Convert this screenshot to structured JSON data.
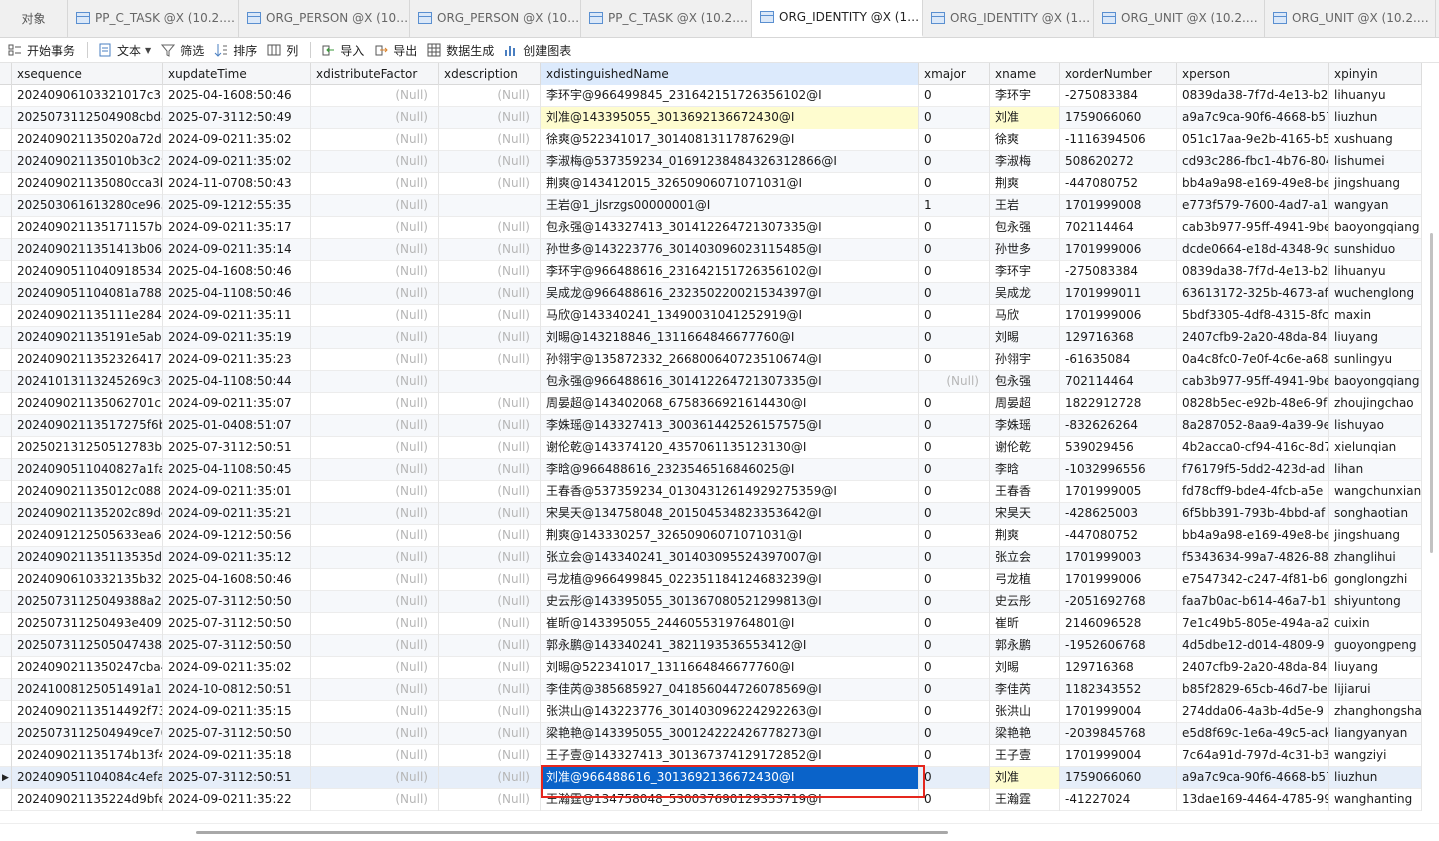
{
  "tabs": {
    "object_label": "对象",
    "items": [
      {
        "label": "PP_C_TASK @X (10.2.1..."
      },
      {
        "label": "ORG_PERSON @X (10...."
      },
      {
        "label": "ORG_PERSON @X (10...."
      },
      {
        "label": "PP_C_TASK @X (10.2.1..."
      },
      {
        "label": "ORG_IDENTITY @X (10...."
      },
      {
        "label": "ORG_IDENTITY @X (10..."
      },
      {
        "label": "ORG_UNIT @X (10.2.1..."
      },
      {
        "label": "ORG_UNIT @X (10.2.1..."
      }
    ]
  },
  "toolbar": {
    "begin_transaction": "开始事务",
    "text": "文本",
    "filter": "筛选",
    "sort": "排序",
    "columns": "列",
    "import": "导入",
    "export": "导出",
    "generate_data": "数据生成",
    "create_chart": "创建图表"
  },
  "grid": {
    "columns": [
      "xsequence",
      "xupdateTime",
      "xdistributeFactor",
      "xdescription",
      "xdistinguishedName",
      "xmajor",
      "xname",
      "xorderNumber",
      "xperson",
      "xpinyin"
    ],
    "null_text": "(Null)",
    "rows": [
      [
        "20240906103321017c37",
        "2025-04-16 08:50:46",
        null,
        null,
        "李环宇@966499845_231642151726356102@I",
        "0",
        "李环宇",
        "-275083384",
        "0839da38-7f7d-4e13-b2",
        "lihuanyu"
      ],
      [
        "20250731125049 08cbda",
        "2025-07-31 12:50:49",
        null,
        null,
        "刘准@143395055_301369213667243 0@I",
        "0",
        "刘准",
        "1759066060",
        "a9a7c9ca-90f6-4668-b57",
        "liuzhun"
      ],
      [
        "202409021135020a72d5",
        "2024-09-02 11:35:02",
        null,
        null,
        "徐爽@522341017_3014081311787629@I",
        "0",
        "徐爽",
        "-1116394506",
        "051c17aa-9e2b-4165-b5",
        "xushuang"
      ],
      [
        "202409021135010b3c29",
        "2024-09-02 11:35:02",
        null,
        null,
        "李淑梅@537359234_016912384843263128 66@I",
        "0",
        "李淑梅",
        "508620272",
        "cd93c286-fbc1-4b76-804",
        "lishumei"
      ],
      [
        "202409021135080cca3b",
        "2024-11-07 08:50:43",
        null,
        null,
        "荆爽@143412015_3265090607107103 1@I",
        "0",
        "荆爽",
        "-447080752",
        "bb4a9a98-e169-49e8-be",
        "jingshuang"
      ],
      [
        "2025030616132 80ce965",
        "2025-09-12 12:55:35",
        null,
        "",
        "王岩@1_jlsrzgs00000001@I",
        "1",
        "王岩",
        "1701999008",
        "e773f579-7600-4ad7-a1",
        "wangyan"
      ],
      [
        "20240902113517 1157b2",
        "2024-09-02 11:35:17",
        null,
        null,
        "包永强@143327413_3014122647213073 35@I",
        "0",
        "包永强",
        "702114464",
        "cab3b977-95ff-4941-9be",
        "baoyongqiang"
      ],
      [
        "20240902113514 13b065",
        "2024-09-02 11:35:14",
        null,
        null,
        "孙世多@143223776_3014030960231154 85@I",
        "0",
        "孙世多",
        "1701999006",
        "dcde0664-e18d-4348-9c",
        "sunshiduo"
      ],
      [
        "202409051104 0918534a",
        "2025-04-16 08:50:46",
        null,
        null,
        "李环宇@966488616_2316421517263561 02@I",
        "0",
        "李环宇",
        "-275083384",
        "0839da38-7f7d-4e13-b2",
        "lihuanyu"
      ],
      [
        "202409051104 081a788f3",
        "2025-04-11 08:50:46",
        null,
        null,
        "吴成龙@966488616_2323502200215343 97@I",
        "0",
        "吴成龙",
        "1701999011",
        "63613172-325b-4673-af",
        "wuchenglong"
      ],
      [
        "20240902113511 1e2840",
        "2024-09-02 11:35:11",
        null,
        null,
        "马欣@143340241_1349003104125291 9@I",
        "0",
        "马欣",
        "1701999006",
        "5bdf3305-4df8-4315-8fc",
        "maxin"
      ],
      [
        "2024090211351 91e5ab0",
        "2024-09-02 11:35:19",
        null,
        null,
        "刘晹@143218846_1311664846677760@I",
        "0",
        "刘晹",
        "129716368",
        "2407cfb9-2a20-48da-84",
        "liuyang"
      ],
      [
        "20240902113523 26417b",
        "2024-09-02 11:35:23",
        null,
        null,
        "孙翎宇@135872332_2668006407235106 74@I",
        "0",
        "孙翎宇",
        "-61635084",
        "0a4c8fc0-7e0f-4c6e-a68",
        "sunlingyu"
      ],
      [
        "202410131 13245269c30",
        "2025-04-11 08:50:44",
        null,
        "",
        "包永强@966488616_3014122647213073 35@I",
        "(Null)",
        "包永强",
        "702114464",
        "cab3b977-95ff-4941-9be",
        "baoyongqiang"
      ],
      [
        "202409021135 062701c3",
        "2024-09-02 11:35:07",
        null,
        null,
        "周晏超@143402068_6758366921614430@I",
        "0",
        "周晏超",
        "1822912728",
        "0828b5ec-e92b-48e6-9f",
        "zhoujingchao"
      ],
      [
        "20240902113517 275f6b",
        "2025-01-04 08:51:07",
        null,
        null,
        "李姝瑶@143327413_3003614425261575 75@I",
        "0",
        "李姝瑶",
        "-832626264",
        "8a287052-8aa9-4a39-9e",
        "lishuyao"
      ],
      [
        "20250213125051 2783b0",
        "2025-07-31 12:50:51",
        null,
        null,
        "谢伦乾@143374120_4357061135123130@I",
        "0",
        "谢伦乾",
        "539029456",
        "4b2acca0-cf94-416c-8d7",
        "xielunqian"
      ],
      [
        "202409051104 0827a1fa",
        "2025-04-11 08:50:45",
        null,
        null,
        "李晗@966488616_2323546516846025@I",
        "0",
        "李晗",
        "-1032996556",
        "f76179f5-5dd2-423d-ad",
        "lihan"
      ],
      [
        "202409021135012c0881",
        "2024-09-02 11:35:01",
        null,
        null,
        "王春香@537359234_0130431261492927 5359@I",
        "0",
        "王春香",
        "1701999005",
        "fd78cff9-bde4-4fcb-a5e",
        "wangchunxiang"
      ],
      [
        "202409021135202c89dc",
        "2024-09-02 11:35:21",
        null,
        null,
        "宋昊天@134758048_2015045348233536 42@I",
        "0",
        "宋昊天",
        "-428625003",
        "6f5bb391-793b-4bbd-af",
        "songhaotian"
      ],
      [
        "2024091212505 633ea65",
        "2024-09-12 12:50:56",
        null,
        null,
        "荆爽@143330257_3265090607107103 1@I",
        "0",
        "荆爽",
        "-447080752",
        "bb4a9a98-e169-49e8-be",
        "jingshuang"
      ],
      [
        "20240902113511 3535de",
        "2024-09-02 11:35:12",
        null,
        null,
        "张立会@143340241_3014030955243970 07@I",
        "0",
        "张立会",
        "1701999003",
        "f5343634-99a7-4826-88",
        "zhanglihui"
      ],
      [
        "2024090610332 135b328",
        "2025-04-16 08:50:46",
        null,
        null,
        "弓龙植@966499845_0223511841246832 39@I",
        "0",
        "弓龙植",
        "1701999006",
        "e7547342-c247-4f81-b6",
        "gonglongzhi"
      ],
      [
        "2025073112504 9388a2e",
        "2025-07-31 12:50:50",
        null,
        null,
        "史云彤@143395055_3013670805212998 13@I",
        "0",
        "史云彤",
        "-2051692768",
        "faa7b0ac-b614-46a7-b1",
        "shiyuntong"
      ],
      [
        "2025073112504 93e4095",
        "2025-07-31 12:50:50",
        null,
        null,
        "崔昕@143395055_2446055319764801@I",
        "0",
        "崔昕",
        "2146096528",
        "7e1c49b5-805e-494a-a2",
        "cuixin"
      ],
      [
        "2025073112505 0474384",
        "2025-07-31 12:50:50",
        null,
        null,
        "郭永鹏@143340241_3821193536553412@I",
        "0",
        "郭永鹏",
        "-1952606768",
        "4d5dbe12-d014-4809-9",
        "guoyongpeng"
      ],
      [
        "20240902113502 47cba4",
        "2024-09-02 11:35:02",
        null,
        null,
        "刘晹@522341017_1311664846677760@I",
        "0",
        "刘晹",
        "129716368",
        "2407cfb9-2a20-48da-84",
        "liuyang"
      ],
      [
        "2024100812505 1491a17",
        "2024-10-08 12:50:51",
        null,
        null,
        "李佳芮@385685927_0418560447260785 69@I",
        "0",
        "李佳芮",
        "1182343552",
        "b85f2829-65cb-46d7-be",
        "lijiarui"
      ],
      [
        "202409021135 14492f73c",
        "2024-09-02 11:35:15",
        null,
        null,
        "张洪山@143223776_3014030962242922 63@I",
        "0",
        "张洪山",
        "1701999004",
        "274dda06-4a3b-4d5e-9",
        "zhanghongshan"
      ],
      [
        "2025073112504 94 9ce70",
        "2025-07-31 12:50:50",
        null,
        null,
        "梁艳艳@143395055_3001242224267782 73@I",
        "0",
        "梁艳艳",
        "-2039845768",
        "e5d8f69c-1e6a-49c5-ack",
        "liangyanyan"
      ],
      [
        "202409021135 174b13f4",
        "2024-09-02 11:35:18",
        null,
        null,
        "王子壹@143327413_3013673741291728 52@I",
        "0",
        "王子壹",
        "1701999004",
        "7c64a91d-797d-4c31-b3",
        "wangziyi"
      ],
      [
        "202409051104 084c4efa2",
        "2025-07-31 12:50:51",
        null,
        null,
        "刘准@966488616_3013692136672430@I",
        "0",
        "刘准",
        "1759066060",
        "a9a7c9ca-90f6-4668-b57",
        "liuzhun"
      ],
      [
        "202409021135 224d9bfe",
        "2024-09-02 11:35:22",
        null,
        null,
        "王瀚霆@134758048_5300376901293537 19@I",
        "0",
        "王瀚霆",
        "-41227024",
        "13dae169-4464-4785-99",
        "wanghanting"
      ]
    ]
  }
}
